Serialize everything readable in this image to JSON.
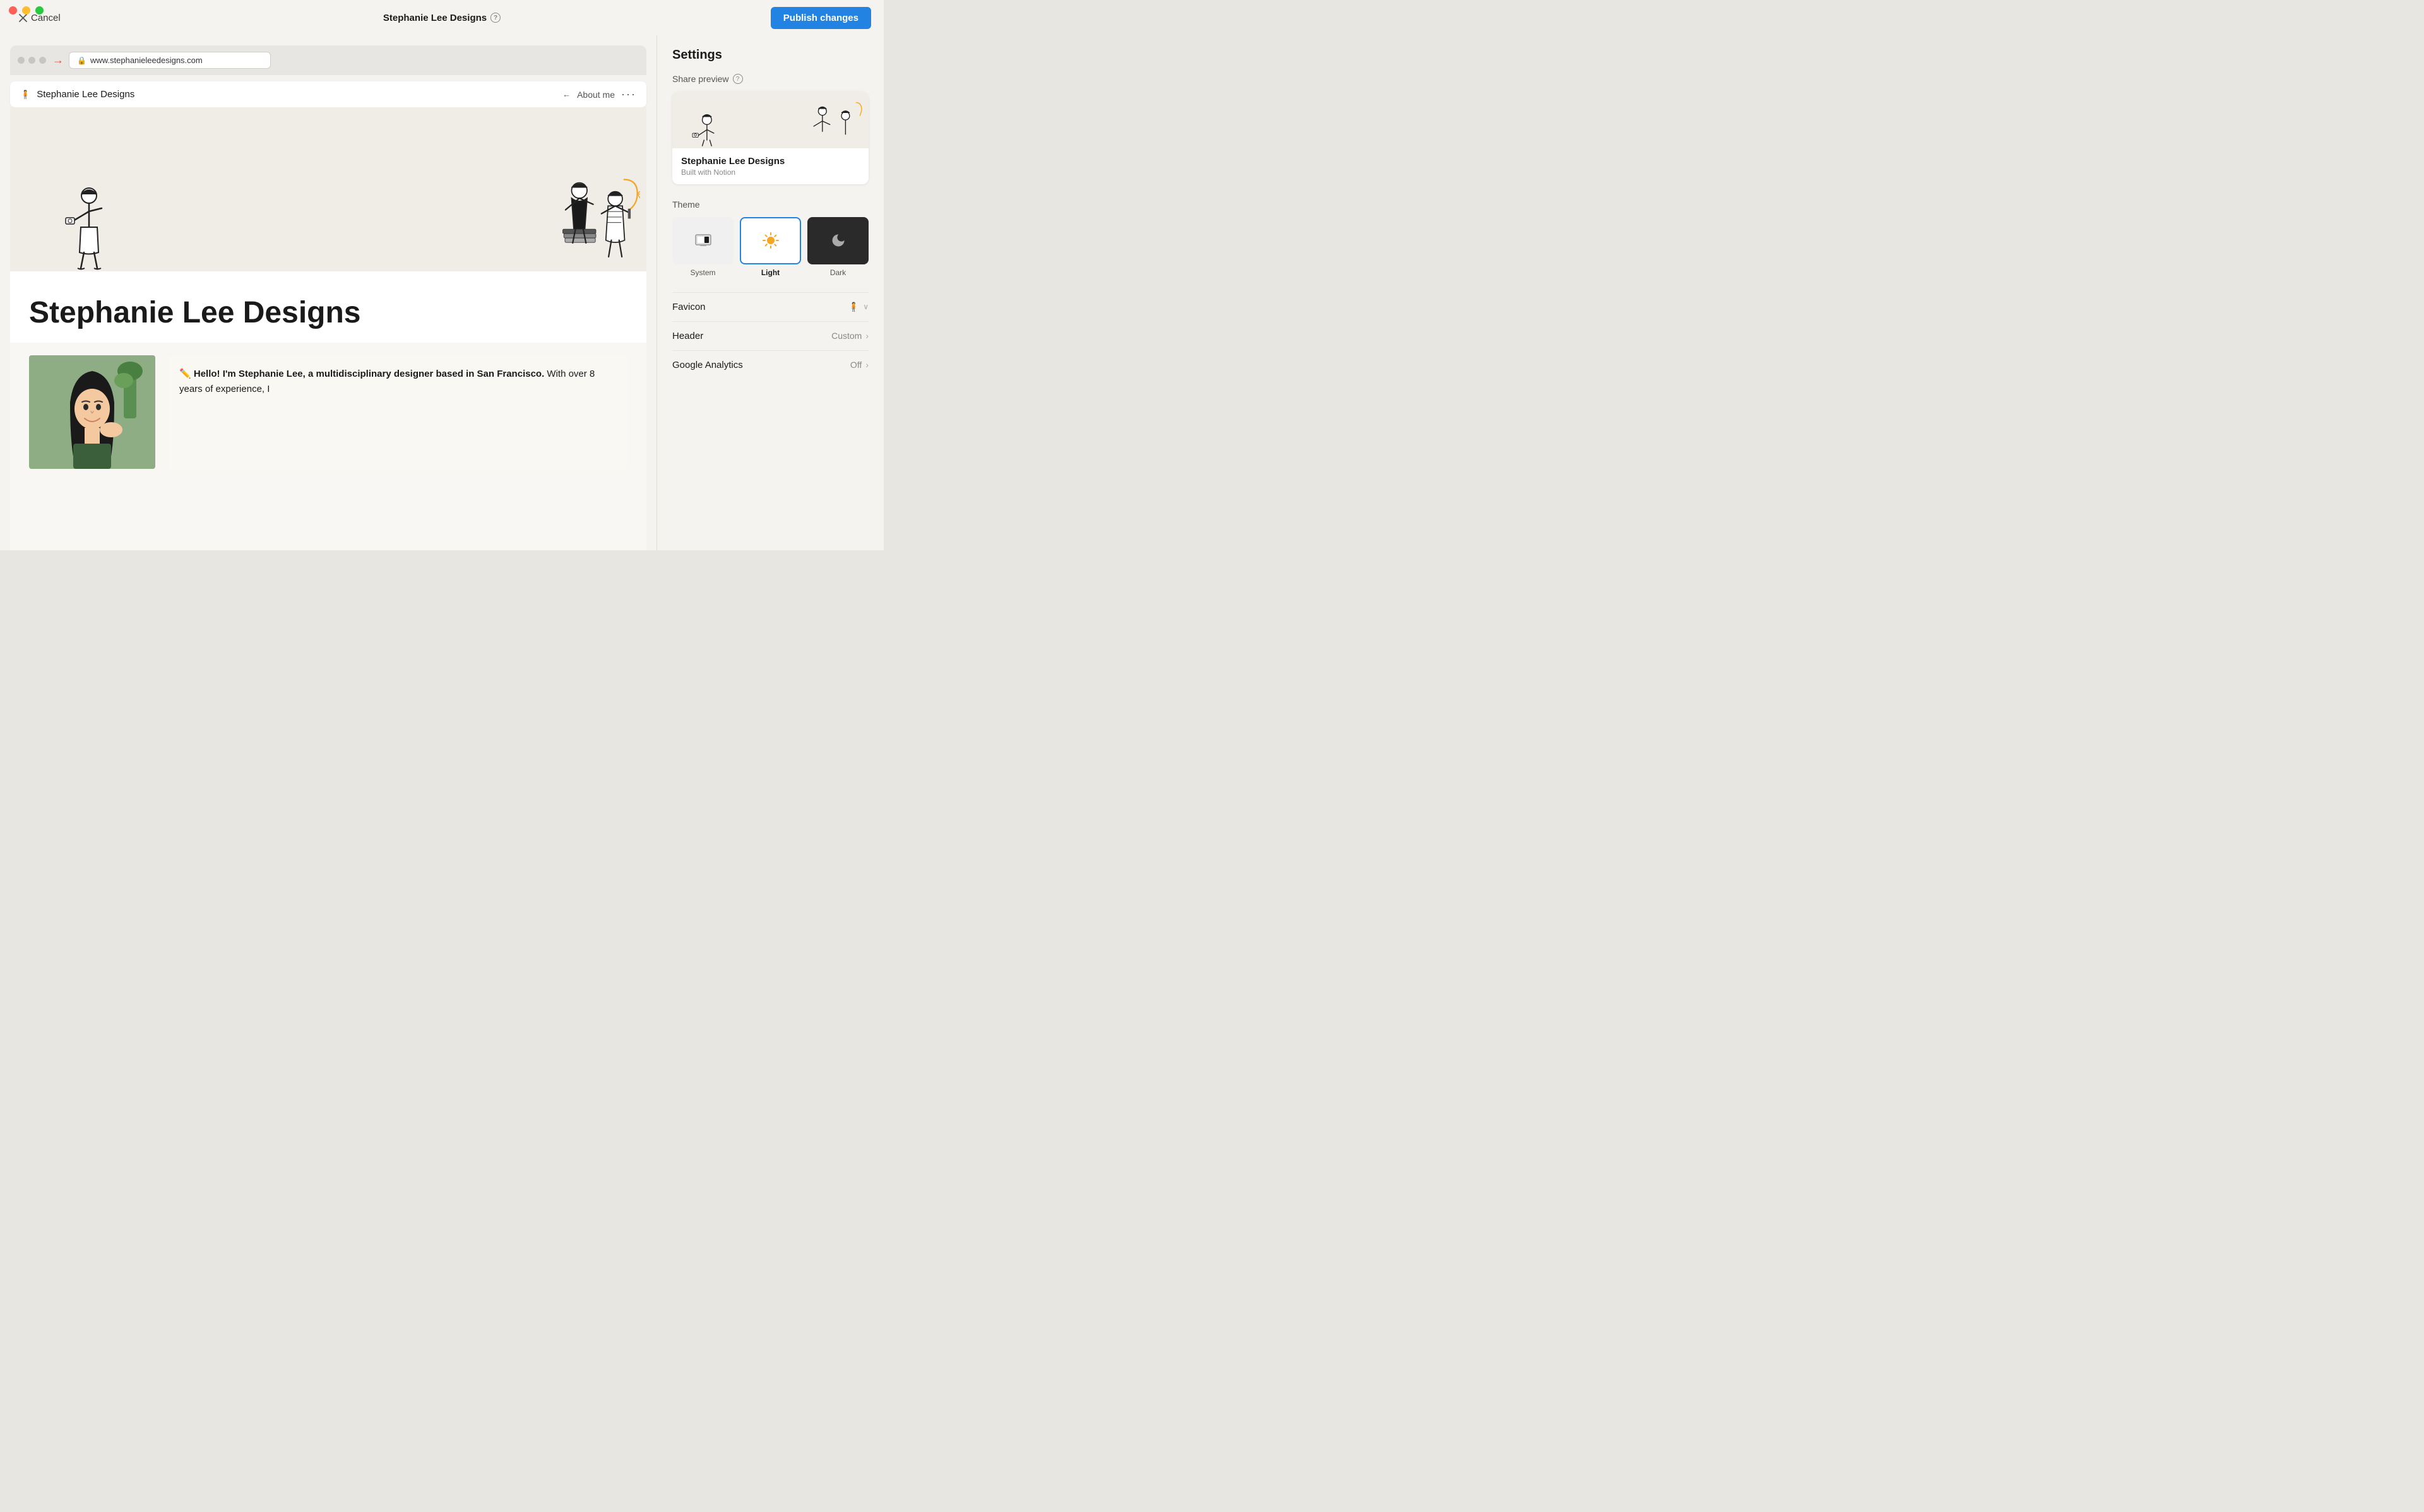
{
  "trafficLights": {
    "red": "#fe5f57",
    "yellow": "#febc2e",
    "green": "#28c840"
  },
  "topBar": {
    "cancelLabel": "Cancel",
    "pageTitle": "Stephanie Lee Designs",
    "helpIcon": "?",
    "publishLabel": "Publish changes"
  },
  "browser": {
    "urlText": "www.stephanieleedesigns.com",
    "navSiteTitle": "Stephanie Lee Designs",
    "navAboutMe": "About me"
  },
  "pageContent": {
    "siteTitleLarge": "Stephanie Lee Designs",
    "introEmoji": "✏️",
    "introText": "Hello! I'm Stephanie Lee, a multidisciplinary designer based in San Francisco.",
    "introTextContinued": " With over 8 years of experience, I"
  },
  "settings": {
    "title": "Settings",
    "sharePreviewLabel": "Share preview",
    "helpIcon": "?",
    "previewSiteTitle": "Stephanie Lee Designs",
    "previewSiteSub": "Built with Notion",
    "themeLabel": "Theme",
    "themeOptions": [
      {
        "id": "system",
        "label": "System",
        "selected": false
      },
      {
        "id": "light",
        "label": "Light",
        "selected": true
      },
      {
        "id": "dark",
        "label": "Dark",
        "selected": false
      }
    ],
    "rows": [
      {
        "id": "favicon",
        "label": "Favicon",
        "value": "",
        "hasChevron": true,
        "hasDropdown": true
      },
      {
        "id": "header",
        "label": "Header",
        "value": "Custom",
        "hasChevron": true
      },
      {
        "id": "google-analytics",
        "label": "Google Analytics",
        "value": "Off",
        "hasChevron": true
      }
    ]
  }
}
